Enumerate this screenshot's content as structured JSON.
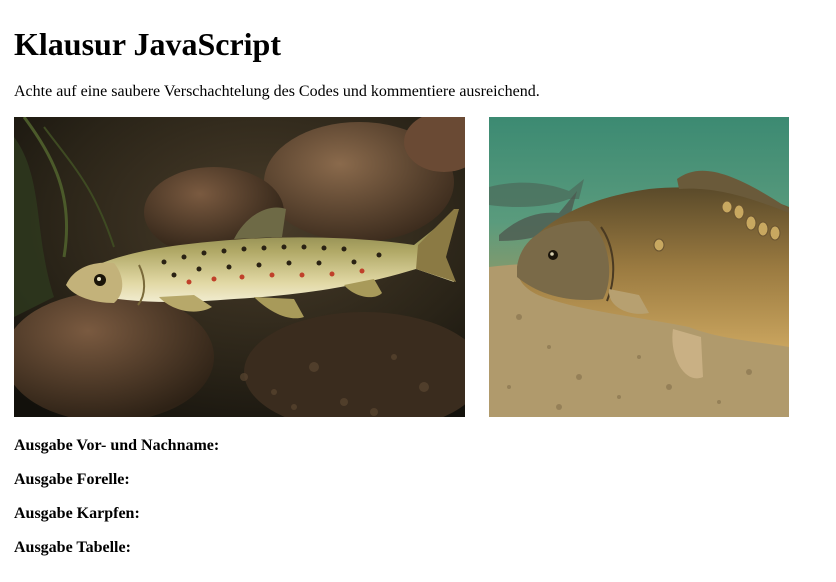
{
  "page": {
    "title": "Klausur JavaScript",
    "intro": "Achte auf eine saubere Verschachtelung des Codes und kommentiere ausreichend."
  },
  "images": [
    {
      "name": "trout-photo",
      "depicts": "brown trout swimming over stones"
    },
    {
      "name": "carp-photo",
      "depicts": "mirror carp swimming over sandy riverbed"
    }
  ],
  "outputs": [
    {
      "label": "Ausgabe Vor- und Nachname:",
      "value": ""
    },
    {
      "label": "Ausgabe Forelle:",
      "value": ""
    },
    {
      "label": "Ausgabe Karpfen:",
      "value": ""
    },
    {
      "label": "Ausgabe Tabelle:",
      "value": ""
    }
  ]
}
